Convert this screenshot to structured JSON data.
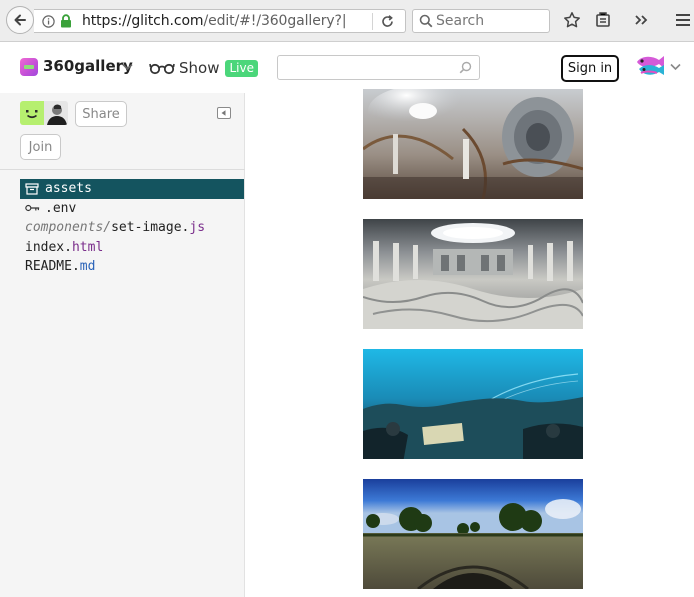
{
  "browser": {
    "url_host": "https://glitch.com",
    "url_path": "/edit/#!/360gallery?|",
    "search_placeholder": "Search"
  },
  "header": {
    "project_name": "360gallery",
    "show_label": "Show",
    "live_badge": "Live",
    "search_value": "",
    "signin_label": "Sign in"
  },
  "sidebar": {
    "share_label": "Share",
    "join_label": "Join",
    "files": [
      {
        "dir": "",
        "name": "assets",
        "ext": "",
        "icon": "folder-icon"
      },
      {
        "dir": "",
        "name": ".env",
        "ext": "",
        "icon": "key-icon"
      },
      {
        "dir": "components/",
        "name": "set-image.",
        "ext": "js",
        "icon": ""
      },
      {
        "dir": "",
        "name": "index.",
        "ext": "html",
        "icon": ""
      },
      {
        "dir": "",
        "name": "README.",
        "ext": "md",
        "icon": ""
      }
    ]
  },
  "gallery": {
    "images": [
      "panorama-rotunda",
      "panorama-marble-hall",
      "panorama-underwater",
      "panorama-park"
    ]
  },
  "colors": {
    "live_green": "#4bd67a",
    "active_file_bg": "#14545f",
    "project_logo_pink": "#f06ad3"
  }
}
